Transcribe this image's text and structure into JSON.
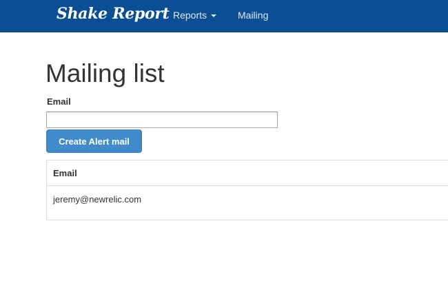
{
  "navbar": {
    "brand": "Shake Report",
    "links": [
      {
        "label": "Reports",
        "has_dropdown": true
      },
      {
        "label": "Mailing",
        "has_dropdown": false
      }
    ],
    "background_color": "#0a4f93"
  },
  "main": {
    "title": "Mailing list",
    "form": {
      "email_label": "Email",
      "email_value": "",
      "email_placeholder": "",
      "submit_label": "Create Alert mail"
    },
    "table": {
      "headers": [
        "Email"
      ],
      "rows": [
        [
          "jeremy@newrelic.com"
        ]
      ]
    }
  },
  "colors": {
    "primary_button": "#428bca",
    "text": "#333333"
  }
}
